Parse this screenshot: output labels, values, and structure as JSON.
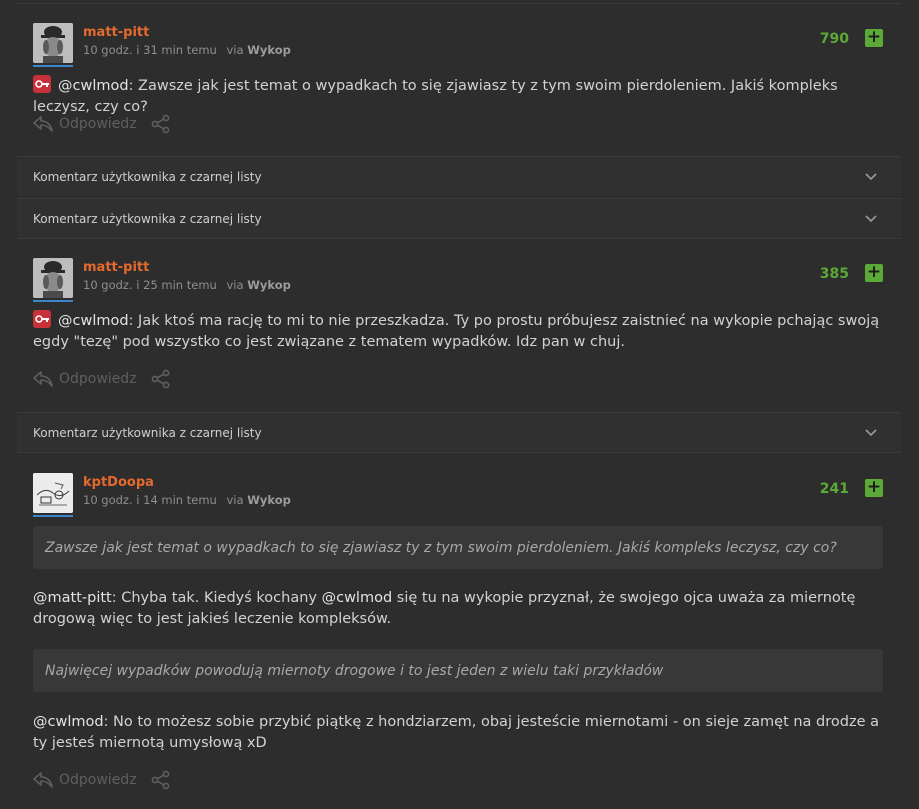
{
  "actions": {
    "reply_label": "Odpowiedz"
  },
  "blacklist_label": "Komentarz użytkownika z czarnej listy",
  "comments": [
    {
      "username": "matt-pitt",
      "time": "10 godz. i 31 min temu",
      "via_prefix": "via",
      "via_source": "Wykop",
      "votes": "790",
      "plus": "+",
      "mention": "@cwlmod",
      "text": ": Zawsze jak jest temat o wypadkach to się zjawiasz ty z tym swoim pierdoleniem. Jakiś kompleks leczysz, czy co?"
    },
    {
      "username": "matt-pitt",
      "time": "10 godz. i 25 min temu",
      "via_prefix": "via",
      "via_source": "Wykop",
      "votes": "385",
      "plus": "+",
      "mention": "@cwlmod",
      "text": ": Jak ktoś ma rację to mi to nie przeszkadza. Ty po prostu próbujesz zaistnieć na wykopie pchając swoją egdy \"tezę\" pod wszystko co jest związane z tematem wypadków. Idz pan w chuj."
    },
    {
      "username": "kptDoopa",
      "time": "10 godz. i 14 min temu",
      "via_prefix": "via",
      "via_source": "Wykop",
      "votes": "241",
      "plus": "+",
      "quote1": "Zawsze jak jest temat o wypadkach to się zjawiasz ty z tym swoim pierdoleniem. Jakiś kompleks leczysz, czy co?",
      "mention1": "@matt-pitt",
      "text1a": ": Chyba tak. Kiedyś kochany ",
      "mention1b": "@cwlmod",
      "text1b": " się tu na wykopie przyznał, że swojego ojca uważa za miernotę drogową więc to jest jakieś leczenie kompleksów.",
      "quote2": "Najwięcej wypadków powodują miernoty drogowe i to jest jeden z wielu taki przykładów",
      "mention2": "@cwlmod",
      "text2": ": No to możesz sobie przybić piątkę z hondziarzem, obaj jesteście miernotami - on sieje zamęt na drodze a ty jesteś miernotą umysłową xD"
    }
  ]
}
